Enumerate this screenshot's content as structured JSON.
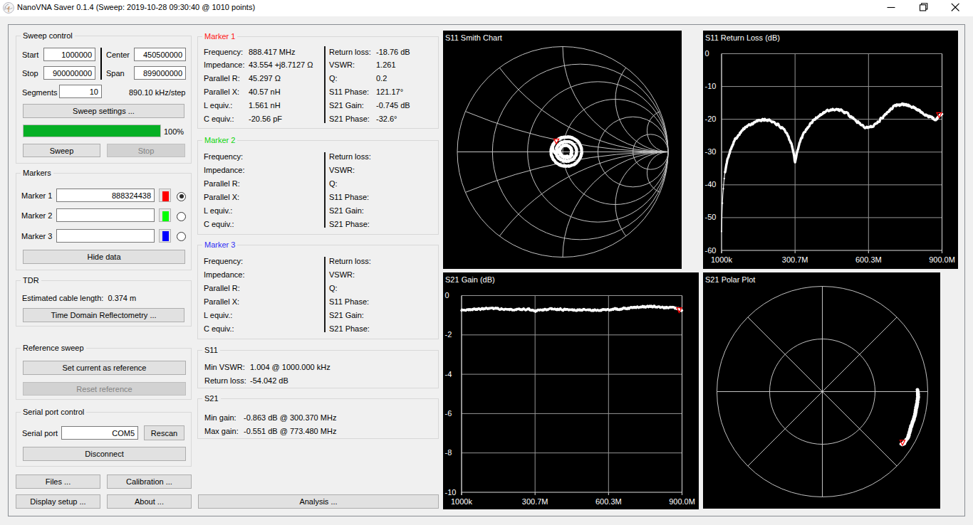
{
  "window": {
    "title": "NanoVNA Saver 0.1.4 (Sweep: 2019-10-28 09:30:40 @ 1010 points)",
    "controls": [
      "minimize",
      "restore",
      "close"
    ]
  },
  "sweep_control": {
    "title": "Sweep control",
    "start_label": "Start",
    "start_value": "1000000",
    "stop_label": "Stop",
    "stop_value": "900000000",
    "center_label": "Center",
    "center_value": "450500000",
    "span_label": "Span",
    "span_value": "899000000",
    "segments_label": "Segments",
    "segments_value": "10",
    "step_text": "890.10 kHz/step",
    "sweep_settings_button": "Sweep settings ...",
    "progress_percent": 100,
    "progress_text": "100%",
    "sweep_button": "Sweep",
    "stop_button": "Stop"
  },
  "markers_panel": {
    "title": "Markers",
    "rows": [
      {
        "label": "Marker 1",
        "value": "888324438",
        "color": "#ff0000",
        "selected": true
      },
      {
        "label": "Marker 2",
        "value": "",
        "color": "#00ff00",
        "selected": false
      },
      {
        "label": "Marker 3",
        "value": "",
        "color": "#0000ff",
        "selected": false
      }
    ],
    "hide_data_button": "Hide data"
  },
  "tdr": {
    "title": "TDR",
    "cable_length_text": "Estimated cable length:  0.374 m",
    "button": "Time Domain Reflectometry ..."
  },
  "reference": {
    "title": "Reference sweep",
    "set_button": "Set current as reference",
    "reset_button": "Reset reference"
  },
  "serial": {
    "title": "Serial port control",
    "port_label": "Serial port",
    "port_value": "COM5",
    "rescan_button": "Rescan",
    "disconnect_button": "Disconnect"
  },
  "bottom_buttons": {
    "files": "Files ...",
    "calibration": "Calibration ...",
    "display_setup": "Display setup ...",
    "about": "About ...",
    "analysis": "Analysis ..."
  },
  "marker_info": {
    "left_labels": [
      "Frequency:",
      "Impedance:",
      "Parallel R:",
      "Parallel X:",
      "L equiv.:",
      "C equiv.:"
    ],
    "right_labels": [
      "Return loss:",
      "VSWR:",
      "Q:",
      "S11 Phase:",
      "S21 Gain:",
      "S21 Phase:"
    ],
    "boxes": [
      {
        "title": "Marker 1",
        "color": "#ff1414",
        "left_values": [
          "888.417 MHz",
          "43.554 +j8.7127 Ω",
          "45.297 Ω",
          "40.57 nH",
          "1.561 nH",
          "-20.56 pF"
        ],
        "right_values": [
          "-18.76 dB",
          "1.261",
          "0.2",
          "121.17°",
          "-0.745 dB",
          "-32.6°"
        ]
      },
      {
        "title": "Marker 2",
        "color": "#0bd60b",
        "left_values": [
          "",
          "",
          "",
          "",
          "",
          ""
        ],
        "right_values": [
          "",
          "",
          "",
          "",
          "",
          ""
        ]
      },
      {
        "title": "Marker 3",
        "color": "#2f2ff5",
        "left_values": [
          "",
          "",
          "",
          "",
          "",
          ""
        ],
        "right_values": [
          "",
          "",
          "",
          "",
          "",
          ""
        ]
      }
    ]
  },
  "s11_stats": {
    "title": "S11",
    "rows": [
      {
        "label": "Min VSWR:",
        "value": "1.004 @ 1000.000 kHz"
      },
      {
        "label": "Return loss:",
        "value": "-54.042 dB"
      }
    ]
  },
  "s21_stats": {
    "title": "S21",
    "rows": [
      {
        "label": "Min gain:",
        "value": "-0.863 dB @ 300.370 MHz"
      },
      {
        "label": "Max gain:",
        "value": "-0.551 dB @ 773.480 MHz"
      }
    ]
  },
  "chart_data": [
    {
      "type": "smith",
      "title": "S11 Smith Chart",
      "series": "S11",
      "grid": {
        "resistance_circles": [
          0.2,
          0.5,
          1,
          2,
          5
        ],
        "reactance_arcs": [
          0.2,
          0.5,
          1,
          2,
          5
        ],
        "color": "#c2c2c2"
      },
      "trace": {
        "color": "#ffffff",
        "shape": "spiral of nearly-circular loops around chart center",
        "loop_gamma_magnitudes": [
          0.068,
          0.108,
          0.156
        ],
        "turns": 3.52,
        "phase_deg_end": 105.6,
        "center_offset_gamma": [
          0.027,
          0.005
        ]
      },
      "marker": {
        "freq_mhz": 888.417,
        "s11_db": -18.76,
        "s11_phase_deg": 121.17,
        "color": "#ff0000"
      }
    },
    {
      "type": "line",
      "title": "S11 Return Loss (dB)",
      "series": "S11 Return Loss",
      "x_range_mhz": [
        1,
        900
      ],
      "ylim": [
        -60,
        0
      ],
      "yticks": [
        0,
        -10,
        -20,
        -30,
        -40,
        -50,
        -60
      ],
      "xticks": [
        {
          "label": "1000k",
          "mhz": 1
        },
        {
          "label": "300.7M",
          "mhz": 300.7
        },
        {
          "label": "600.3M",
          "mhz": 600.3
        },
        {
          "label": "900.0M",
          "mhz": 900
        }
      ],
      "keypoints_mhz_db": [
        [
          1,
          -54.0
        ],
        [
          2,
          -50.5
        ],
        [
          4,
          -46.0
        ],
        [
          7,
          -42.0
        ],
        [
          12,
          -37.8
        ],
        [
          18,
          -34.8
        ],
        [
          25,
          -32.3
        ],
        [
          35,
          -29.6
        ],
        [
          50,
          -27.0
        ],
        [
          70,
          -24.6
        ],
        [
          90,
          -23.0
        ],
        [
          110,
          -21.9
        ],
        [
          135,
          -20.9
        ],
        [
          160,
          -20.3
        ],
        [
          175,
          -20.15
        ],
        [
          195,
          -20.3
        ],
        [
          215,
          -20.9
        ],
        [
          235,
          -21.9
        ],
        [
          255,
          -23.3
        ],
        [
          272,
          -25.0
        ],
        [
          285,
          -27.2
        ],
        [
          294,
          -29.8
        ],
        [
          298,
          -31.6
        ],
        [
          300,
          -33.0
        ],
        [
          300.7,
          -33.45
        ],
        [
          301.5,
          -33.1
        ],
        [
          303,
          -31.9
        ],
        [
          310,
          -29.7
        ],
        [
          320,
          -27.1
        ],
        [
          335,
          -24.6
        ],
        [
          355,
          -22.2
        ],
        [
          380,
          -20.0
        ],
        [
          405,
          -18.5
        ],
        [
          430,
          -17.5
        ],
        [
          450,
          -17.0
        ],
        [
          468,
          -16.9
        ],
        [
          487,
          -17.3
        ],
        [
          510,
          -18.2
        ],
        [
          535,
          -19.6
        ],
        [
          560,
          -21.0
        ],
        [
          580,
          -22.0
        ],
        [
          597,
          -22.5
        ],
        [
          610,
          -22.4
        ],
        [
          625,
          -21.6
        ],
        [
          645,
          -20.3
        ],
        [
          665,
          -18.8
        ],
        [
          685,
          -17.2
        ],
        [
          702,
          -16.2
        ],
        [
          718,
          -15.6
        ],
        [
          733,
          -15.3
        ],
        [
          748,
          -15.5
        ],
        [
          765,
          -15.9
        ],
        [
          785,
          -16.5
        ],
        [
          805,
          -17.2
        ],
        [
          825,
          -18.1
        ],
        [
          843,
          -19.0
        ],
        [
          858,
          -19.6
        ],
        [
          870,
          -19.9
        ],
        [
          880,
          -19.7
        ],
        [
          888,
          -19.0
        ],
        [
          894,
          -18.6
        ],
        [
          900,
          -18.4
        ]
      ],
      "noise_db": 0.22,
      "smooth_passes": 1,
      "dotted_start_below_mhz": 14,
      "marker": {
        "freq_mhz": 888.417,
        "value_db": -18.76,
        "color": "#ff0000"
      },
      "grid_color": "#969696",
      "axis_color": "#dcdcdc",
      "trace_color": "#ffffff",
      "text_color": "#ffffff"
    },
    {
      "type": "line",
      "title": "S21 Gain (dB)",
      "series": "S21 Gain",
      "x_range_mhz": [
        1,
        900
      ],
      "ylim": [
        -10,
        0
      ],
      "yticks": [
        0,
        -2,
        -4,
        -6,
        -8,
        -10
      ],
      "xticks": [
        {
          "label": "1000k",
          "mhz": 1
        },
        {
          "label": "300.7M",
          "mhz": 300.7
        },
        {
          "label": "600.3M",
          "mhz": 600.3
        },
        {
          "label": "900.0M",
          "mhz": 900
        }
      ],
      "keypoints_mhz_db": [
        [
          1,
          -0.73
        ],
        [
          30,
          -0.71
        ],
        [
          60,
          -0.7
        ],
        [
          90,
          -0.68
        ],
        [
          120,
          -0.665
        ],
        [
          150,
          -0.67
        ],
        [
          180,
          -0.69
        ],
        [
          210,
          -0.7
        ],
        [
          240,
          -0.71
        ],
        [
          270,
          -0.72
        ],
        [
          292,
          -0.73
        ],
        [
          298,
          -0.78
        ],
        [
          300.4,
          -0.863
        ],
        [
          303,
          -0.79
        ],
        [
          308,
          -0.75
        ],
        [
          330,
          -0.72
        ],
        [
          360,
          -0.705
        ],
        [
          390,
          -0.7
        ],
        [
          420,
          -0.71
        ],
        [
          450,
          -0.715
        ],
        [
          480,
          -0.72
        ],
        [
          510,
          -0.73
        ],
        [
          540,
          -0.735
        ],
        [
          570,
          -0.73
        ],
        [
          600,
          -0.72
        ],
        [
          625,
          -0.7
        ],
        [
          650,
          -0.675
        ],
        [
          675,
          -0.645
        ],
        [
          700,
          -0.615
        ],
        [
          725,
          -0.585
        ],
        [
          750,
          -0.565
        ],
        [
          773,
          -0.551
        ],
        [
          790,
          -0.565
        ],
        [
          810,
          -0.59
        ],
        [
          828,
          -0.625
        ],
        [
          845,
          -0.6
        ],
        [
          860,
          -0.59
        ],
        [
          872,
          -0.63
        ],
        [
          882,
          -0.67
        ],
        [
          890,
          -0.71
        ],
        [
          900,
          -0.745
        ]
      ],
      "noise_db": 0.025,
      "smooth_passes": 2,
      "marker": {
        "freq_mhz": 888.417,
        "value_db": -0.745,
        "color": "#ff0000"
      },
      "grid_color": "#969696",
      "axis_color": "#dcdcdc",
      "trace_color": "#ffffff",
      "text_color": "#ffffff"
    },
    {
      "type": "polar",
      "title": "S21 Polar Plot",
      "series": "S21",
      "grid": {
        "rings": [
          0.5,
          1.0
        ],
        "spoke_step_deg": 45,
        "color": "#c2c2c2"
      },
      "trace": {
        "color": "#ffffff",
        "gain_keypoints_mhz_db": [
          [
            1,
            -0.73
          ],
          [
            100,
            -0.68
          ],
          [
            200,
            -0.7
          ],
          [
            300,
            -0.74
          ],
          [
            400,
            -0.705
          ],
          [
            500,
            -0.725
          ],
          [
            600,
            -0.72
          ],
          [
            700,
            -0.615
          ],
          [
            773,
            -0.551
          ],
          [
            828,
            -0.625
          ],
          [
            860,
            -0.59
          ],
          [
            900,
            -0.745
          ]
        ],
        "phase_deg_start": 1.2,
        "phase_deg_end": -33.8
      },
      "marker": {
        "freq_mhz": 888.417,
        "phase_deg": -32.6,
        "color": "#ff0000"
      }
    }
  ]
}
